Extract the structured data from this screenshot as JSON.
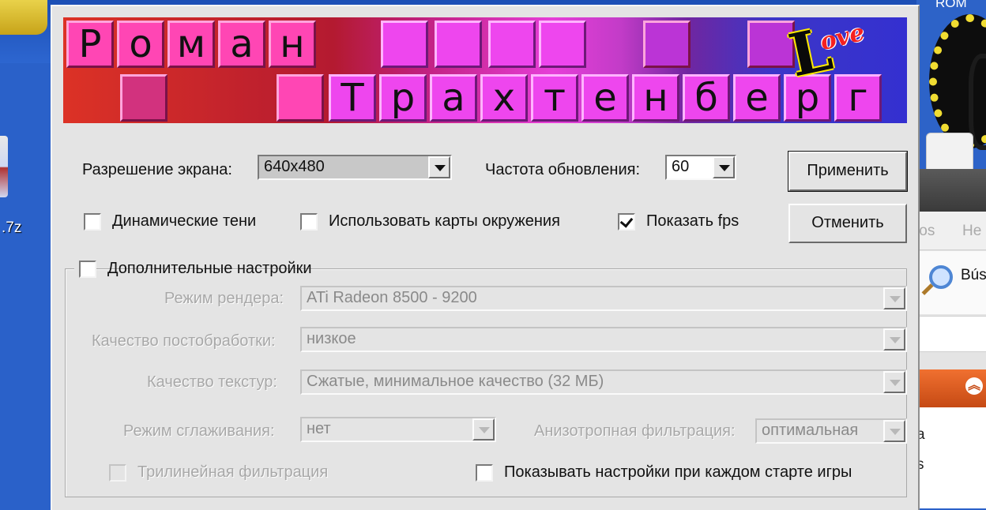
{
  "desktop": {
    "file_label": ".7z",
    "bg_rom_label": "ROM",
    "bg_tab_1": "tos",
    "bg_tab_2": "He",
    "bg_search_label": "Bús",
    "bg_list_1": "a",
    "bg_list_2": "s"
  },
  "banner": {
    "name_letters": [
      "Р",
      "о",
      "м",
      "а",
      "н"
    ],
    "surname_letters": [
      "Т",
      "р",
      "а",
      "х",
      "т",
      "е",
      "н",
      "б",
      "е",
      "р",
      "г"
    ],
    "love_big": "L",
    "love_word": "ove"
  },
  "display": {
    "resolution_label": "Разрешение экрана:",
    "resolution_value": "640x480",
    "refresh_label": "Частота обновления:",
    "refresh_value": "60"
  },
  "options": {
    "dynamic_shadows": {
      "label": "Динамические тени",
      "checked": false
    },
    "env_maps": {
      "label": "Использовать карты окружения",
      "checked": false
    },
    "show_fps": {
      "label": "Показать fps",
      "checked": true
    }
  },
  "buttons": {
    "apply": "Применить",
    "cancel": "Отменить"
  },
  "advanced": {
    "title": "Дополнительные настройки",
    "enabled": false,
    "render_mode_label": "Режим рендера:",
    "render_mode_value": "ATi Radeon 8500 - 9200",
    "postprocess_label": "Качество постобработки:",
    "postprocess_value": "низкое",
    "texture_label": "Качество текстур:",
    "texture_value": "Сжатые, минимальное качество (32 МБ)",
    "aa_label": "Режим сглаживания:",
    "aa_value": "нет",
    "aniso_label": "Анизотропная фильтрация:",
    "aniso_value": "оптимальная",
    "trilinear_label": "Трилинейная фильтрация",
    "show_settings_label": "Показывать настройки при каждом старте игры"
  }
}
